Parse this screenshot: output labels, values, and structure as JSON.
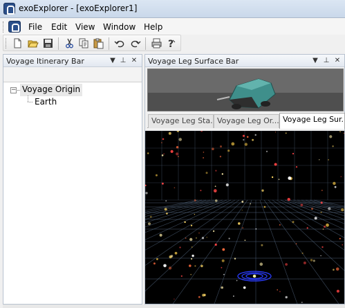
{
  "window": {
    "title": "exoExplorer - [exoExplorer1]"
  },
  "menubar": {
    "items": [
      {
        "label": "File"
      },
      {
        "label": "Edit"
      },
      {
        "label": "View"
      },
      {
        "label": "Window"
      },
      {
        "label": "Help"
      }
    ]
  },
  "toolbar": {
    "buttons": [
      {
        "icon": "new-document-icon"
      },
      {
        "icon": "open-folder-icon"
      },
      {
        "icon": "save-icon"
      },
      {
        "icon": "cut-icon"
      },
      {
        "icon": "copy-icon"
      },
      {
        "icon": "paste-icon"
      },
      {
        "icon": "undo-icon"
      },
      {
        "icon": "redo-icon"
      },
      {
        "icon": "print-icon"
      },
      {
        "icon": "help-icon"
      }
    ]
  },
  "left_panel": {
    "title": "Voyage Itinerary Bar",
    "tree": {
      "root": "Voyage Origin",
      "children": [
        "Earth"
      ]
    }
  },
  "right_panel": {
    "title": "Voyage Leg Surface Bar",
    "tabs": [
      {
        "label": "Voyage Leg Sta..."
      },
      {
        "label": "Voyage Leg Or..."
      },
      {
        "label": "Voyage Leg Sur..."
      }
    ],
    "active_tab": "Voyage Leg Sur..."
  },
  "colors": {
    "selection_ring": "#2a3cff",
    "grid_line": "#5a6f8a",
    "vehicle_teal": "#3f8f8b"
  }
}
